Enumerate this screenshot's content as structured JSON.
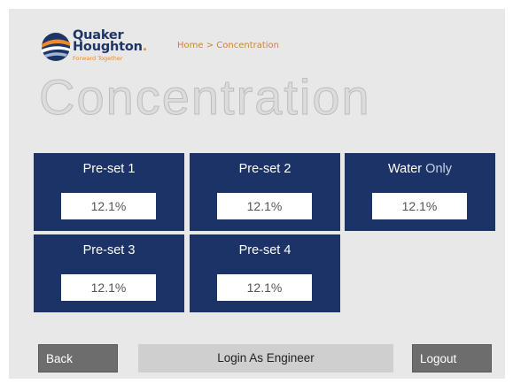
{
  "logo": {
    "line1": "Quaker",
    "line2": "Houghton",
    "tagline": "Forward Together"
  },
  "breadcrumb": "Home > Concentration",
  "page_title": "Concentration",
  "tiles": [
    {
      "label": "Pre-set 1",
      "value": "12.1%"
    },
    {
      "label": "Pre-set 2",
      "value": "12.1%"
    },
    {
      "label_primary": "Water",
      "label_accent": "Only",
      "value": "12.1%"
    },
    {
      "label": "Pre-set 3",
      "value": "12.1%"
    },
    {
      "label": "Pre-set 4",
      "value": "12.1%"
    }
  ],
  "buttons": {
    "back": "Back",
    "login_engineer": "Login As Engineer",
    "logout": "Logout"
  },
  "colors": {
    "tile_bg": "#1b3366",
    "screen_bg": "#e8e8e8",
    "brand_navy": "#1d3566",
    "brand_orange": "#f08a24"
  }
}
